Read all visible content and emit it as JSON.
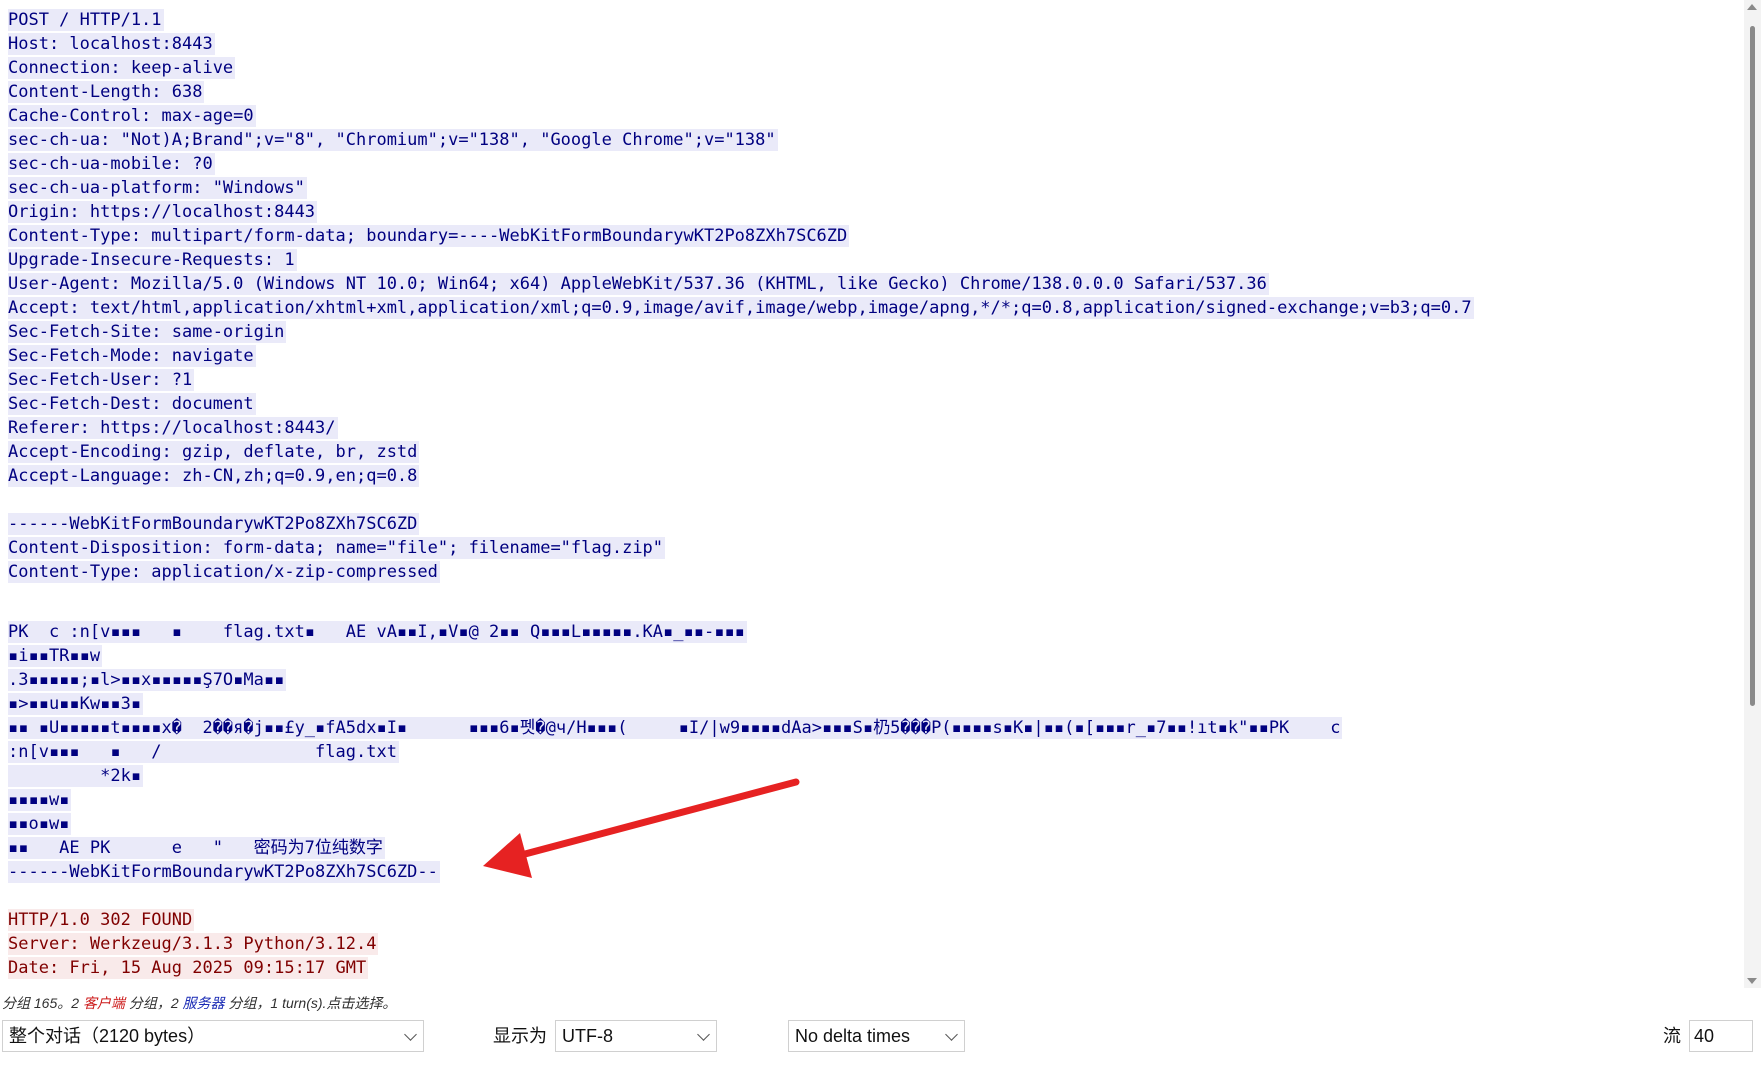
{
  "stream": {
    "request_lines": [
      "POST / HTTP/1.1",
      "Host: localhost:8443",
      "Connection: keep-alive",
      "Content-Length: 638",
      "Cache-Control: max-age=0",
      "sec-ch-ua: \"Not)A;Brand\";v=\"8\", \"Chromium\";v=\"138\", \"Google Chrome\";v=\"138\"",
      "sec-ch-ua-mobile: ?0",
      "sec-ch-ua-platform: \"Windows\"",
      "Origin: https://localhost:8443",
      "Content-Type: multipart/form-data; boundary=----WebKitFormBoundarywKT2Po8ZXh7SC6ZD",
      "Upgrade-Insecure-Requests: 1",
      "User-Agent: Mozilla/5.0 (Windows NT 10.0; Win64; x64) AppleWebKit/537.36 (KHTML, like Gecko) Chrome/138.0.0.0 Safari/537.36",
      "Accept: text/html,application/xhtml+xml,application/xml;q=0.9,image/avif,image/webp,image/apng,*/*;q=0.8,application/signed-exchange;v=b3;q=0.7",
      "Sec-Fetch-Site: same-origin",
      "Sec-Fetch-Mode: navigate",
      "Sec-Fetch-User: ?1",
      "Sec-Fetch-Dest: document",
      "Referer: https://localhost:8443/",
      "Accept-Encoding: gzip, deflate, br, zstd",
      "Accept-Language: zh-CN,zh;q=0.9,en;q=0.8"
    ],
    "multipart_header_lines": [
      "------WebKitFormBoundarywKT2Po8ZXh7SC6ZD",
      "Content-Disposition: form-data; name=\"file\"; filename=\"flag.zip\"",
      "Content-Type: application/x-zip-compressed"
    ],
    "binary_lines": [
      "PK\u0003\u0004\u0014  c :n\u0005[\u0005v▪▪▪   ▪\u0005  \u0005 \u0005 flag.txt▪\u0005   AE\u0001\u0007 \u0005vA▪▪I\u0005\u0005,\u0005▪\u0005V▪@ 2▪▪ Q▪▪▪L▪▪▪▪▪.KA▪_▪\u0005▪-▪\u0005▪\u0005▪",
      "\u0005▪i▪▪TR\u0005▪▪w",
      ".3▪\u0005▪▪▪▪;▪l>▪▪x\u0005▪▪▪▪▪Ş7O▪Ma\u0005▪▪",
      "▪>▪▪u▪\u0005▪Kw▪▪3\u0005▪",
      "▪▪ ▪U▪\u0005▪▪▪▪t▪▪▪▪x�  2\u0005��\u0005\u0005\u0005я�j▪▪£y_▪fA5dx▪I▪      ▪▪▪6▪펫�@ч/H▪▪▪(     ▪\u0005I/\u0005|w9▪▪\u0005▪▪dAa>▪▪▪S\u0005▪㭁\u00055���P(▪\u0005\u0005▪▪▪\u0005s▪K▪|▪\u0005▪(▪[▪▪▪r_▪7▪▪!ıt▪k\"▪▪PK \u0005 \u0005  c",
      ":n\u0005[\u0005v▪▪▪   ▪\u0005  \u0005 /               flag.txt",
      "        \u0005 \u0005*2k▪",
      "▪▪▪▪w▪",
      "▪▪o▪w▪",
      "▪▪\u0005   AE\u0001\u0007 PK\u0005\u0006      e   \"  \u0005 密码为7位纯数字",
      "------WebKitFormBoundarywKT2Po8ZXh7SC6ZD--"
    ],
    "response_lines": [
      "HTTP/1.0 302 FOUND",
      "Server: Werkzeug/3.1.3 Python/3.12.4",
      "Date: Fri, 15 Aug 2025 09:15:17 GMT"
    ]
  },
  "status": {
    "prefix": "分组 165。2 ",
    "client_word": "客户端",
    "mid": " 分组，2 ",
    "server_word": "服务器",
    "suffix": " 分组，1 turn(s).点击选择。"
  },
  "controls": {
    "conversation_select": "整个对话（2120 bytes）",
    "show_as_label": "显示为",
    "encoding_select": "UTF-8",
    "delta_select": "No delta times",
    "stream_label": "流",
    "stream_number": "40"
  },
  "colors": {
    "client_text": "#000080",
    "client_bg": "#eaeaf9",
    "server_text": "#800000",
    "server_bg": "#f9eaea",
    "annotation_arrow": "#e62222"
  }
}
